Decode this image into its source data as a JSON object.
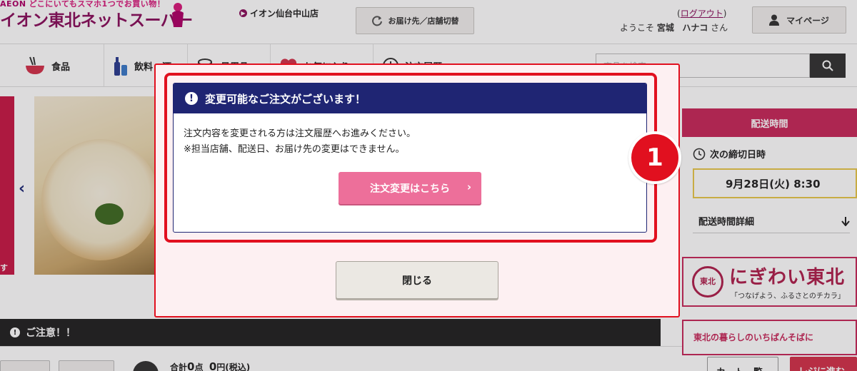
{
  "header": {
    "logo_brand": "AEON",
    "logo_tagline": "どこにいてもスマホ1つでお買い物！",
    "logo_title": "イオン東北ネットスーパー",
    "store_name": "イオン仙台中山店",
    "swap_button": "お届け先／店舗切替",
    "logout_open": "(",
    "logout_label": "ログアウト",
    "logout_close": ")",
    "welcome_prefix": "ようこそ",
    "user_last": "宮城",
    "user_first": "ハナコ",
    "welcome_suffix": "さん",
    "mypage_button": "マイページ"
  },
  "nav": {
    "items": [
      {
        "label": "食品",
        "icon": "bowl-chopsticks-icon"
      },
      {
        "label": "飲料・酒",
        "icon": "bottle-icon"
      },
      {
        "label": "日用品",
        "icon": "toilet-paper-icon"
      },
      {
        "label": "お気に入り",
        "icon": "heart-icon"
      },
      {
        "label": "注文履歴",
        "icon": "clock-icon"
      }
    ],
    "search_placeholder": "商品を検索"
  },
  "page": {
    "hero_caption": "す",
    "notice_bar": "ご注意！！",
    "cart_total_prefix": "合計",
    "cart_total_count": "0",
    "cart_total_count_unit": "点",
    "cart_total_price": "0",
    "cart_total_price_unit": "円(税込)",
    "footer_btn_1": "カート一覧",
    "footer_btn_2": "レジに進む"
  },
  "sidebar": {
    "header": "配送時間",
    "deadline_label": "次の締切日時",
    "deadline_value": "9月28日(火) 8:30",
    "detail_link": "配送時間詳細",
    "nigiwai_seal": "東北",
    "nigiwai_title": "にぎわい東北",
    "nigiwai_sub": "「つなげよう、ふるさとのチカラ」",
    "banner2_text": "東北の暮らしのいちばんそばに"
  },
  "modal": {
    "notice_title": "変更可能なご注文がございます！",
    "notice_line_1": "注文内容を変更される方は注文履歴へお進みください。",
    "notice_line_2": "※担当店舗、配送日、お届け先の変更はできません。",
    "change_button": "注文変更はこちら",
    "close_button": "閉じる",
    "step_badge": "1"
  },
  "colors": {
    "brand_magenta": "#8a0f5c",
    "notice_navy": "#1f2573",
    "highlight_red": "#e1101f",
    "button_pink": "#ed6f9a",
    "sidebar_header": "#c8285a"
  }
}
